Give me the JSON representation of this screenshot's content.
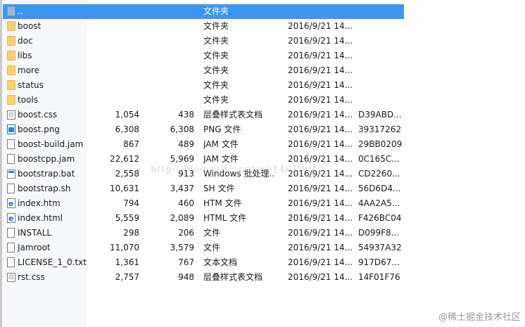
{
  "files": [
    {
      "icon": "up-folder-icon",
      "name": "..",
      "size": "",
      "packed": "",
      "type": "文件夹",
      "modified": "",
      "crc": "",
      "selected": true
    },
    {
      "icon": "folder-icon",
      "name": "boost",
      "size": "",
      "packed": "",
      "type": "文件夹",
      "modified": "2016/9/21 14...",
      "crc": ""
    },
    {
      "icon": "folder-icon",
      "name": "doc",
      "size": "",
      "packed": "",
      "type": "文件夹",
      "modified": "2016/9/21 14...",
      "crc": ""
    },
    {
      "icon": "folder-icon",
      "name": "libs",
      "size": "",
      "packed": "",
      "type": "文件夹",
      "modified": "2016/9/21 14...",
      "crc": ""
    },
    {
      "icon": "folder-icon",
      "name": "more",
      "size": "",
      "packed": "",
      "type": "文件夹",
      "modified": "2016/9/21 14...",
      "crc": ""
    },
    {
      "icon": "folder-icon",
      "name": "status",
      "size": "",
      "packed": "",
      "type": "文件夹",
      "modified": "2016/9/21 14...",
      "crc": ""
    },
    {
      "icon": "folder-icon",
      "name": "tools",
      "size": "",
      "packed": "",
      "type": "文件夹",
      "modified": "2016/9/21 14...",
      "crc": ""
    },
    {
      "icon": "stylesheet-file-icon",
      "name": "boost.css",
      "size": "1,054",
      "packed": "438",
      "type": "层叠样式表文档",
      "modified": "2016/9/21 14...",
      "crc": "D39ABD..."
    },
    {
      "icon": "image-file-icon",
      "name": "boost.png",
      "size": "6,308",
      "packed": "6,308",
      "type": "PNG 文件",
      "modified": "2016/9/21 14...",
      "crc": "39317262"
    },
    {
      "icon": "file-icon",
      "name": "boost-build.jam",
      "size": "867",
      "packed": "489",
      "type": "JAM 文件",
      "modified": "2016/9/21 14...",
      "crc": "29BB0209"
    },
    {
      "icon": "file-icon",
      "name": "boostcpp.jam",
      "size": "22,612",
      "packed": "5,969",
      "type": "JAM 文件",
      "modified": "2016/9/21 14...",
      "crc": "0C165C..."
    },
    {
      "icon": "batch-file-icon",
      "name": "bootstrap.bat",
      "size": "2,558",
      "packed": "913",
      "type": "Windows 批处理...",
      "modified": "2016/9/21 14...",
      "crc": "CD2260..."
    },
    {
      "icon": "file-icon",
      "name": "bootstrap.sh",
      "size": "10,631",
      "packed": "3,437",
      "type": "SH 文件",
      "modified": "2016/9/21 14...",
      "crc": "56D6D4..."
    },
    {
      "icon": "html-file-icon",
      "name": "index.htm",
      "size": "794",
      "packed": "460",
      "type": "HTM 文件",
      "modified": "2016/9/21 14...",
      "crc": "4AA2A5..."
    },
    {
      "icon": "html-file-icon",
      "name": "index.html",
      "size": "5,559",
      "packed": "2,089",
      "type": "HTML 文件",
      "modified": "2016/9/21 14...",
      "crc": "F426BC04"
    },
    {
      "icon": "file-icon",
      "name": "INSTALL",
      "size": "298",
      "packed": "206",
      "type": "文件",
      "modified": "2016/9/21 14...",
      "crc": "D099F8..."
    },
    {
      "icon": "file-icon",
      "name": "Jamroot",
      "size": "11,070",
      "packed": "3,579",
      "type": "文件",
      "modified": "2016/9/21 14...",
      "crc": "54937A32"
    },
    {
      "icon": "file-icon",
      "name": "LICENSE_1_0.txt",
      "size": "1,361",
      "packed": "767",
      "type": "文本文档",
      "modified": "2016/9/21 14...",
      "crc": "917D67..."
    },
    {
      "icon": "stylesheet-file-icon",
      "name": "rst.css",
      "size": "2,757",
      "packed": "948",
      "type": "层叠样式表文档",
      "modified": "2016/9/21 14...",
      "crc": "14F01F76"
    }
  ],
  "watermark": "http://blog.csdn.net/u014613043",
  "brand": "@稀土掘金技术社区",
  "colors": {
    "selection": "#3c96f0",
    "folder": "#f7d268"
  }
}
